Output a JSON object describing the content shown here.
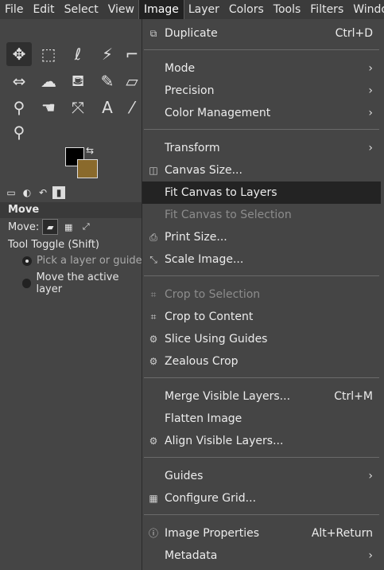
{
  "menubar": {
    "items": [
      "File",
      "Edit",
      "Select",
      "View",
      "Image",
      "Layer",
      "Colors",
      "Tools",
      "Filters",
      "Window"
    ],
    "active": "Image"
  },
  "toolbox": {
    "options_title": "Move",
    "move_label": "Move:",
    "tool_toggle_label": "Tool Toggle  (Shift)",
    "radio_pick": "Pick a layer or guide",
    "radio_move": "Move the active layer",
    "fg_color": "#000000",
    "bg_color": "#8a6a2c"
  },
  "image_menu": {
    "items": [
      {
        "label": "Duplicate",
        "accel": "Ctrl+D",
        "icon": "duplicate-icon"
      },
      {
        "label": "Mode",
        "submenu": true
      },
      {
        "label": "Precision",
        "submenu": true
      },
      {
        "label": "Color Management",
        "submenu": true
      },
      {
        "label": "Transform",
        "submenu": true
      },
      {
        "label": "Canvas Size...",
        "icon": "canvas-size-icon"
      },
      {
        "label": "Fit Canvas to Layers",
        "highlighted": true
      },
      {
        "label": "Fit Canvas to Selection",
        "disabled": true
      },
      {
        "label": "Print Size...",
        "icon": "print-icon"
      },
      {
        "label": "Scale Image...",
        "icon": "scale-icon"
      },
      {
        "label": "Crop to Selection",
        "disabled": true,
        "icon": "crop-icon"
      },
      {
        "label": "Crop to Content",
        "icon": "crop-icon"
      },
      {
        "label": "Slice Using Guides",
        "icon": "slice-icon"
      },
      {
        "label": "Zealous Crop",
        "icon": "zealous-icon"
      },
      {
        "label": "Merge Visible Layers...",
        "accel": "Ctrl+M"
      },
      {
        "label": "Flatten Image"
      },
      {
        "label": "Align Visible Layers...",
        "icon": "align-icon"
      },
      {
        "label": "Guides",
        "submenu": true
      },
      {
        "label": "Configure Grid...",
        "icon": "grid-icon"
      },
      {
        "label": "Image Properties",
        "accel": "Alt+Return",
        "icon": "info-icon"
      },
      {
        "label": "Metadata",
        "submenu": true
      }
    ]
  }
}
